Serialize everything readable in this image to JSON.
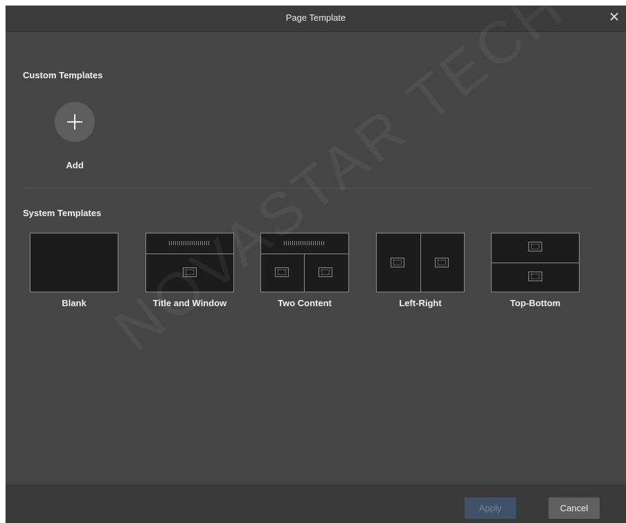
{
  "dialog": {
    "title": "Page Template",
    "close_icon": "close-icon"
  },
  "custom_templates": {
    "heading": "Custom Templates",
    "add_label": "Add",
    "add_icon": "plus-icon"
  },
  "system_templates": {
    "heading": "System Templates",
    "items": [
      {
        "label": "Blank"
      },
      {
        "label": "Title and Window"
      },
      {
        "label": "Two Content"
      },
      {
        "label": "Left-Right"
      },
      {
        "label": "Top-Bottom"
      }
    ]
  },
  "footer": {
    "apply_label": "Apply",
    "cancel_label": "Cancel"
  },
  "watermark": "NOVASTAR TECH",
  "colors": {
    "dialog_bg": "#454545",
    "titlebar_bg": "#3b3b3b",
    "apply_disabled": "#40516a"
  }
}
